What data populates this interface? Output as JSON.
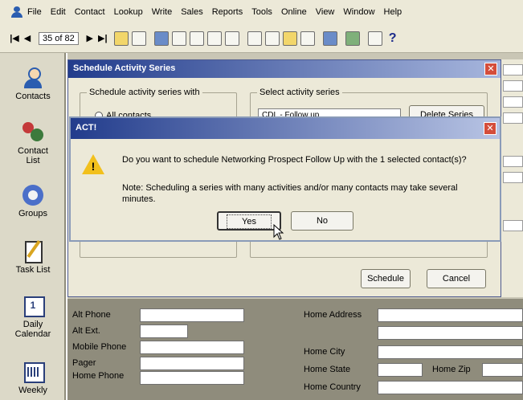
{
  "menu": {
    "items": [
      "File",
      "Edit",
      "Contact",
      "Lookup",
      "Write",
      "Sales",
      "Reports",
      "Tools",
      "Online",
      "View",
      "Window",
      "Help"
    ]
  },
  "toolbar": {
    "record_counter": "35 of 82",
    "nav_first": "|◀",
    "nav_prev": "◀",
    "nav_next": "▶",
    "nav_last": "▶|",
    "help": "?"
  },
  "sidebar": {
    "items": [
      {
        "label": "Contacts",
        "icon": "contacts-icon"
      },
      {
        "label": "Contact List",
        "icon": "contact-list-icon"
      },
      {
        "label": "Groups",
        "icon": "groups-icon"
      },
      {
        "label": "Task List",
        "icon": "task-list-icon"
      },
      {
        "label": "Daily Calendar",
        "icon": "daily-calendar-icon"
      },
      {
        "label": "Weekly",
        "icon": "weekly-calendar-icon"
      }
    ]
  },
  "schedule_dialog": {
    "title": "Schedule Activity Series",
    "group1_label": "Schedule activity series with",
    "radio_all": "All contacts",
    "group2_label": "Select activity series",
    "series_value": "CDL - Follow up",
    "delete_label": "Delete Series",
    "schedule_label": "Schedule",
    "cancel_label": "Cancel"
  },
  "alert_dialog": {
    "title": "ACT!",
    "message": "Do you want to schedule Networking Prospect Follow Up with the 1 selected contact(s)?",
    "note": "Note: Scheduling a series with many activities and/or many contacts may take several minutes.",
    "yes_label": "Yes",
    "no_label": "No"
  },
  "contact_fields": {
    "alt_phone": "Alt Phone",
    "alt_ext": "Alt Ext.",
    "mobile_phone": "Mobile Phone",
    "pager": "Pager",
    "home_phone": "Home Phone",
    "home_address": "Home Address",
    "home_city": "Home City",
    "home_state": "Home State",
    "home_zip": "Home Zip",
    "home_country": "Home Country"
  }
}
